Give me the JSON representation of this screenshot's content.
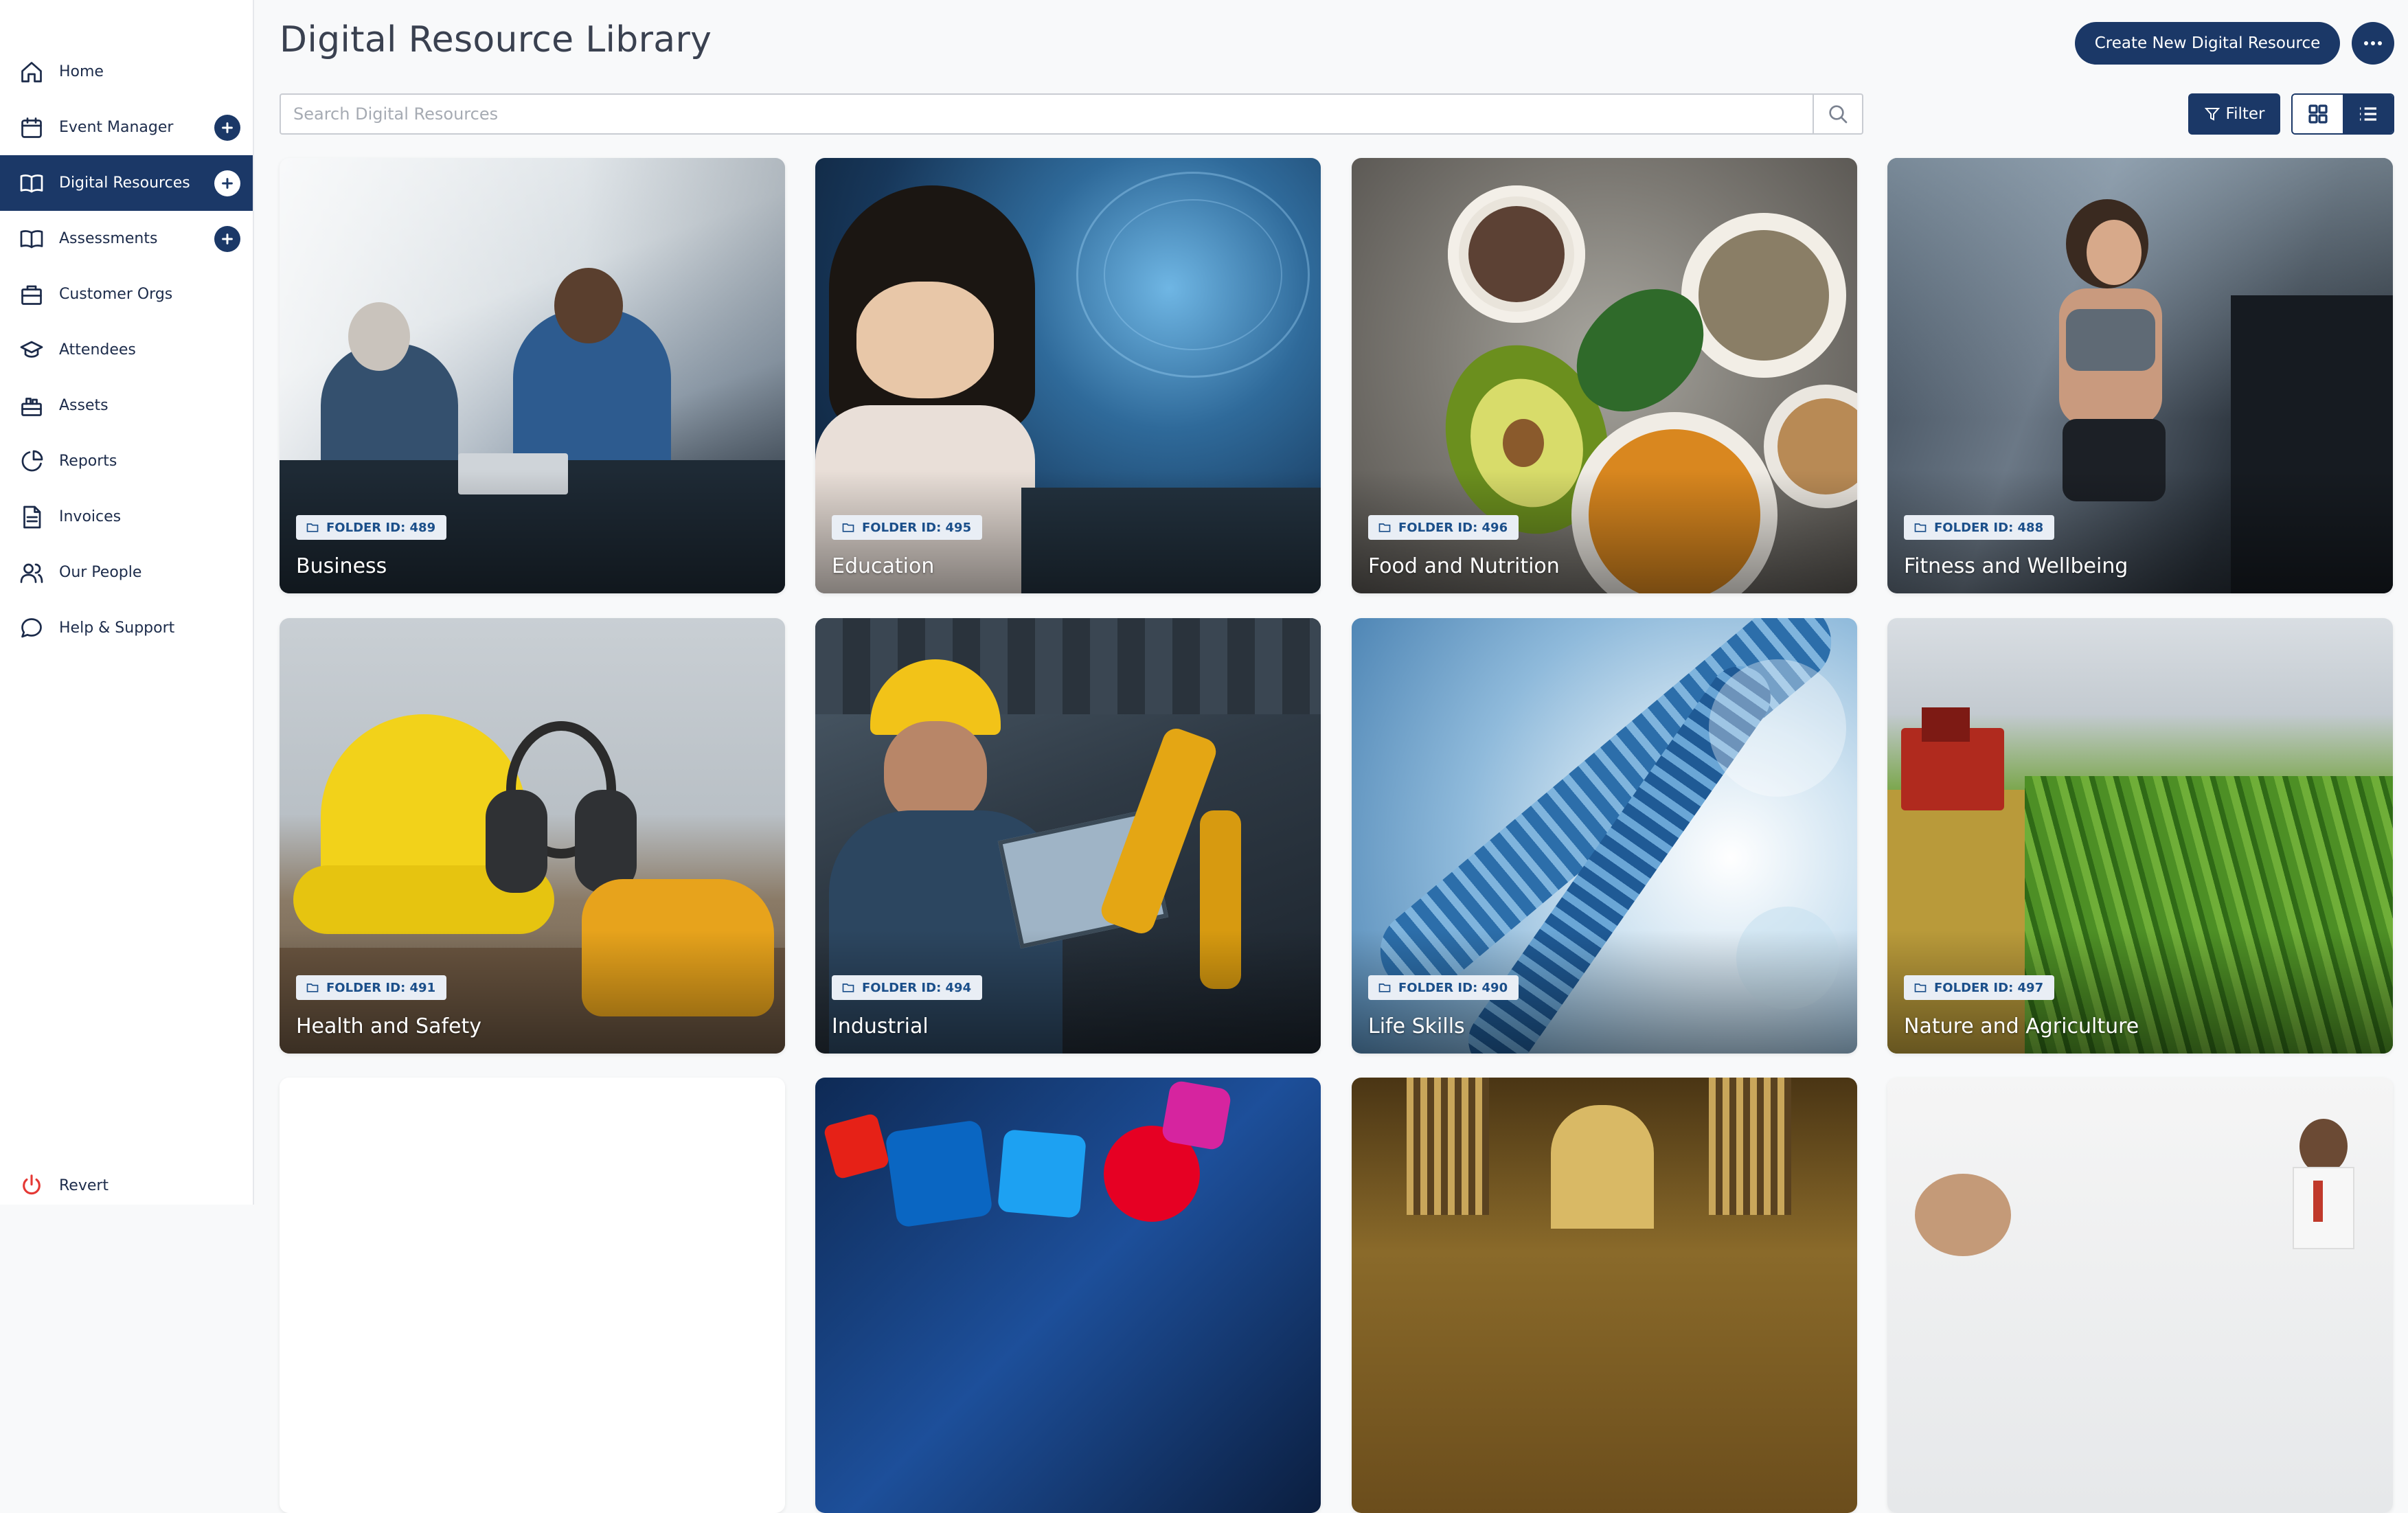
{
  "sidebar": {
    "items": [
      {
        "label": "Home",
        "icon": "home-icon"
      },
      {
        "label": "Event Manager",
        "icon": "calendar-icon",
        "has_add": true
      },
      {
        "label": "Digital Resources",
        "icon": "book-icon",
        "has_add": true,
        "active": true
      },
      {
        "label": "Assessments",
        "icon": "book-icon",
        "has_add": true
      },
      {
        "label": "Customer Orgs",
        "icon": "building-icon"
      },
      {
        "label": "Attendees",
        "icon": "graduation-cap-icon"
      },
      {
        "label": "Assets",
        "icon": "assets-icon"
      },
      {
        "label": "Reports",
        "icon": "pie-chart-icon"
      },
      {
        "label": "Invoices",
        "icon": "invoice-icon"
      },
      {
        "label": "Our People",
        "icon": "people-icon"
      },
      {
        "label": "Help & Support",
        "icon": "chat-bubble-icon"
      }
    ],
    "revert_label": "Revert"
  },
  "header": {
    "title": "Digital Resource Library",
    "create_label": "Create New Digital Resource"
  },
  "search": {
    "placeholder": "Search Digital Resources",
    "value": ""
  },
  "toolbar": {
    "filter_label": "Filter"
  },
  "colors": {
    "primary": "#1b3867",
    "badge_bg": "#e9eef5",
    "badge_text": "#1b4f8a",
    "revert_icon": "#e53935"
  },
  "resources": [
    {
      "folder_id": "FOLDER ID: 489",
      "title": "Business"
    },
    {
      "folder_id": "FOLDER ID: 495",
      "title": "Education"
    },
    {
      "folder_id": "FOLDER ID: 496",
      "title": "Food and Nutrition"
    },
    {
      "folder_id": "FOLDER ID: 488",
      "title": "Fitness and Wellbeing"
    },
    {
      "folder_id": "FOLDER ID: 491",
      "title": "Health and Safety"
    },
    {
      "folder_id": "FOLDER ID: 494",
      "title": "Industrial"
    },
    {
      "folder_id": "FOLDER ID: 490",
      "title": "Life Skills"
    },
    {
      "folder_id": "FOLDER ID: 497",
      "title": "Nature and Agriculture"
    }
  ]
}
